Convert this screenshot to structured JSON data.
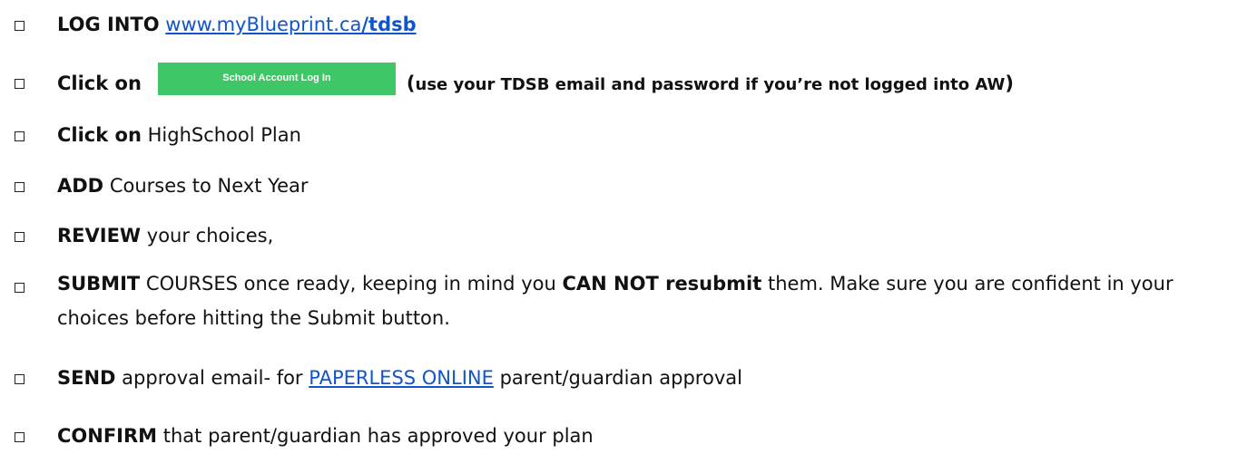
{
  "items": [
    {
      "strong": "LOG INTO",
      "link_plain": "www.myBlueprint.ca",
      "link_bold": "/tdsb"
    },
    {
      "strong": "Click on",
      "button_label": "School Account Log In",
      "paren_open": "(",
      "note": "use your TDSB email and password if you’re not logged into AW",
      "paren_close": ")"
    },
    {
      "strong": "Click on",
      "rest": "HighSchool Plan"
    },
    {
      "strong": "ADD",
      "rest": "Courses to Next Year"
    },
    {
      "strong": "REVIEW",
      "rest": "your choices,"
    },
    {
      "strong": "SUBMIT",
      "rest_a": "COURSES once ready, keeping in mind you",
      "strong_b": "CAN NOT resubmit",
      "rest_b": "them.  Make sure you are confident in your choices before hitting the Submit button."
    },
    {
      "strong": "SEND",
      "rest_a": "approval email- for",
      "link": "PAPERLESS ONLINE",
      "rest_b": "parent/guardian approval"
    },
    {
      "strong": "CONFIRM",
      "rest": "that parent/guardian has approved your plan"
    }
  ]
}
